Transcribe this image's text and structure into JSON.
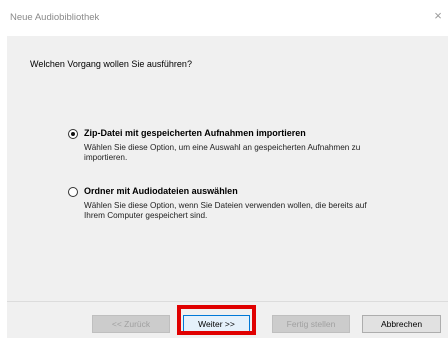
{
  "window": {
    "title": "Neue Audiobibliothek",
    "close_glyph": "×"
  },
  "main": {
    "question": "Welchen Vorgang wollen Sie ausführen?",
    "options": [
      {
        "label": "Zip-Datei mit gespeicherten Aufnahmen importieren",
        "description": "Wählen Sie diese Option, um eine Auswahl an gespeicherten Aufnahmen zu importieren.",
        "selected": true
      },
      {
        "label": "Ordner mit Audiodateien auswählen",
        "description": "Wählen Sie diese Option, wenn Sie Dateien verwenden wollen, die bereits auf Ihrem Computer gespeichert sind.",
        "selected": false
      }
    ]
  },
  "footer": {
    "back_label": "<< Zurück",
    "next_label": "Weiter >>",
    "finish_label": "Fertig stellen",
    "cancel_label": "Abbrechen"
  },
  "colors": {
    "highlight": "#e00000",
    "accent": "#0078d7"
  }
}
